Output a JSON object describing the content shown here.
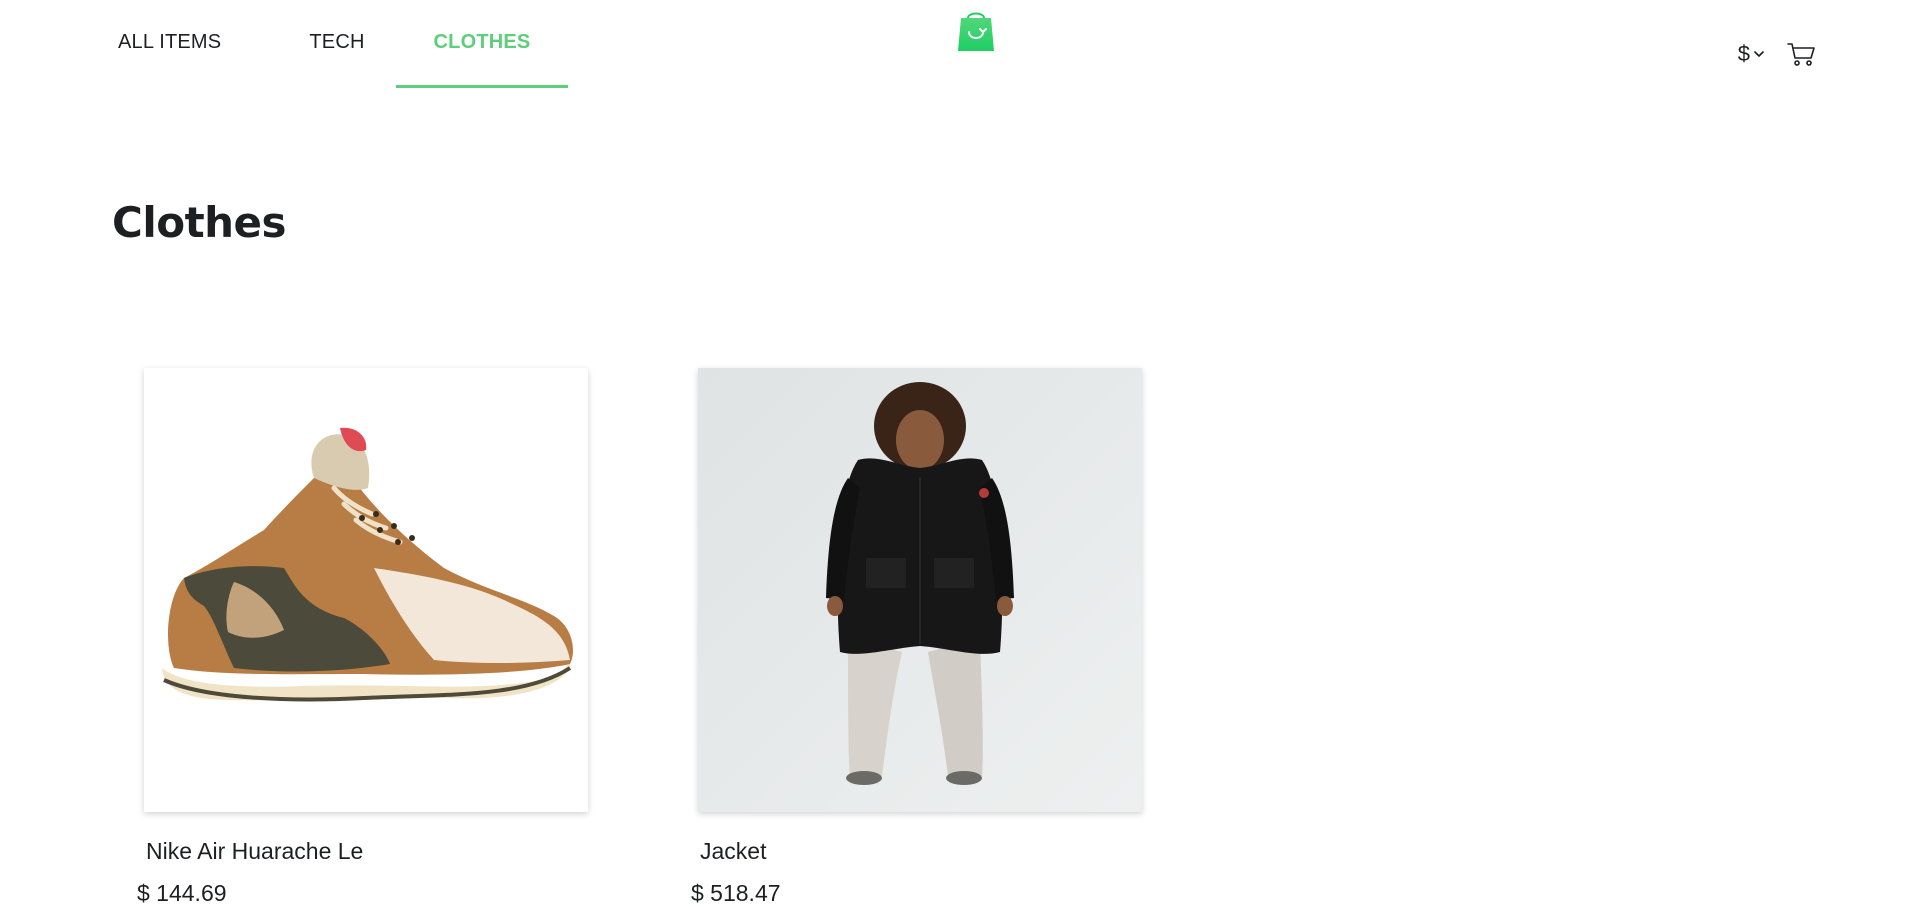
{
  "header": {
    "nav": [
      {
        "label": "ALL ITEMS",
        "active": false
      },
      {
        "label": "TECH",
        "active": false
      },
      {
        "label": "CLOTHES",
        "active": true
      }
    ],
    "logo_icon": "shopping-bag-icon",
    "currency_symbol": "$",
    "currency_icon": "chevron-down-icon",
    "cart_icon": "cart-icon"
  },
  "page": {
    "title": "Clothes"
  },
  "products": [
    {
      "name": "Nike Air Huarache Le",
      "price": "$ 144.69",
      "image": "sneaker-photo"
    },
    {
      "name": "Jacket",
      "price": "$ 518.47",
      "image": "jacket-photo"
    }
  ],
  "colors": {
    "accent": "#5ece7b",
    "text": "#1d1f22"
  }
}
